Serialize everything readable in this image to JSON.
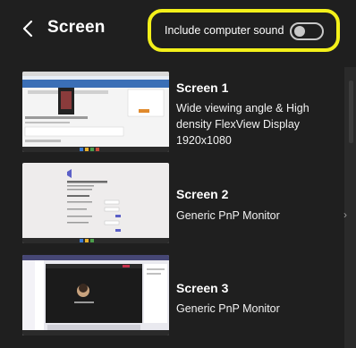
{
  "header": {
    "title": "Screen",
    "sound_label": "Include computer sound",
    "sound_enabled": false,
    "highlight_color": "#f3f01a"
  },
  "screens": [
    {
      "name": "Screen 1",
      "description": "Wide viewing angle & High density FlexView Display 1920x1080"
    },
    {
      "name": "Screen 2",
      "description": "Generic PnP Monitor"
    },
    {
      "name": "Screen 3",
      "description": "Generic PnP Monitor"
    }
  ]
}
